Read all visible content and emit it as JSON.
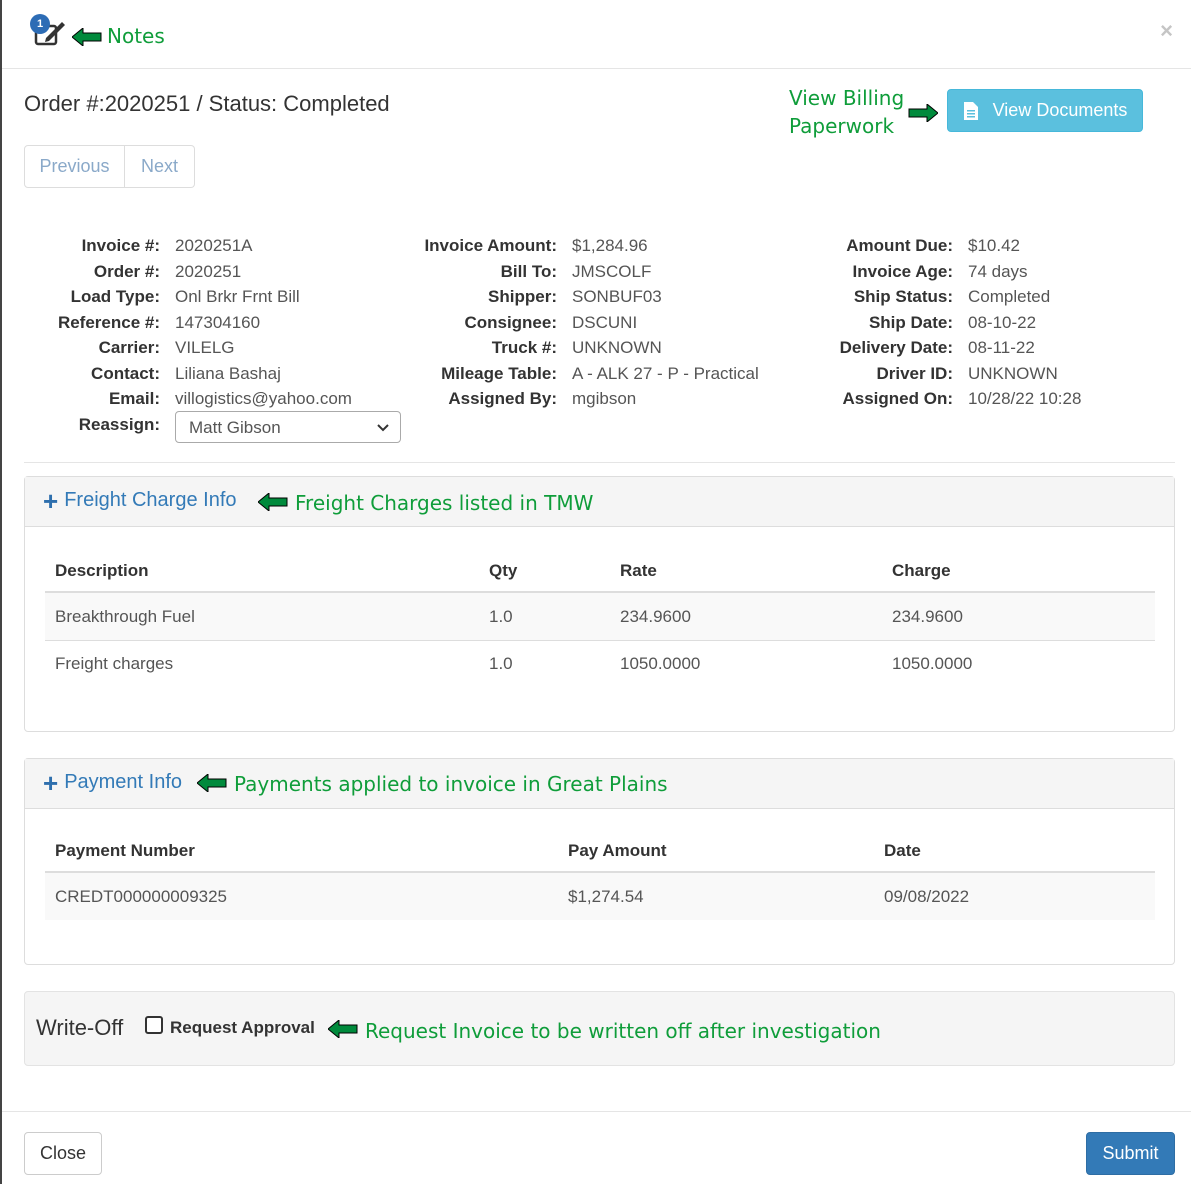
{
  "header": {
    "notes_badge": "1",
    "notes_annotation": "Notes",
    "close_symbol": "×"
  },
  "order": {
    "title": "Order #:2020251 / Status: Completed"
  },
  "pager": {
    "previous": "Previous",
    "next": "Next"
  },
  "view_docs": {
    "annotation_line1": "View Billing",
    "annotation_line2": "Paperwork",
    "label": "View Documents"
  },
  "info": {
    "col1": [
      {
        "label": "Invoice #:",
        "value": "2020251A"
      },
      {
        "label": "Order #:",
        "value": "2020251"
      },
      {
        "label": "Load Type:",
        "value": "Onl Brkr Frnt Bill"
      },
      {
        "label": "Reference #:",
        "value": "147304160"
      },
      {
        "label": "Carrier:",
        "value": "VILELG"
      },
      {
        "label": "Contact:",
        "value": "Liliana Bashaj"
      },
      {
        "label": "Email:",
        "value": "villogistics@yahoo.com"
      },
      {
        "label": "Reassign:",
        "value": "Matt Gibson"
      }
    ],
    "col2": [
      {
        "label": "Invoice Amount:",
        "value": "$1,284.96"
      },
      {
        "label": "Bill To:",
        "value": "JMSCOLF"
      },
      {
        "label": "Shipper:",
        "value": "SONBUF03"
      },
      {
        "label": "Consignee:",
        "value": "DSCUNI"
      },
      {
        "label": "Truck #:",
        "value": "UNKNOWN"
      },
      {
        "label": "Mileage Table:",
        "value": "A - ALK 27 - P - Practical"
      },
      {
        "label": "Assigned By:",
        "value": "mgibson"
      }
    ],
    "col3": [
      {
        "label": "Amount Due:",
        "value": "$10.42"
      },
      {
        "label": "Invoice Age:",
        "value": "74 days"
      },
      {
        "label": "Ship Status:",
        "value": "Completed"
      },
      {
        "label": "Ship Date:",
        "value": "08-10-22"
      },
      {
        "label": "Delivery Date:",
        "value": "08-11-22"
      },
      {
        "label": "Driver ID:",
        "value": "UNKNOWN"
      },
      {
        "label": "Assigned On:",
        "value": "10/28/22 10:28"
      }
    ]
  },
  "freight": {
    "title": "Freight Charge Info",
    "annotation": "Freight Charges listed in TMW",
    "headers": [
      "Description",
      "Qty",
      "Rate",
      "Charge"
    ],
    "rows": [
      [
        "Breakthrough Fuel",
        "1.0",
        "234.9600",
        "234.9600"
      ],
      [
        "Freight charges",
        "1.0",
        "1050.0000",
        "1050.0000"
      ]
    ]
  },
  "payment": {
    "title": "Payment Info",
    "annotation": "Payments applied to invoice in Great Plains",
    "headers": [
      "Payment Number",
      "Pay Amount",
      "Date"
    ],
    "rows": [
      [
        "CREDT000000009325",
        "$1,274.54",
        "09/08/2022"
      ]
    ]
  },
  "writeoff": {
    "label": "Write-Off",
    "checkbox_label": "Request Approval",
    "annotation": "Request Invoice to be written off after investigation"
  },
  "footer": {
    "close": "Close",
    "submit": "Submit"
  },
  "colors": {
    "annotation": "#0f9d3a",
    "arrow": "#008a3c",
    "link": "#337ab7",
    "info_button": "#5bc0de",
    "primary": "#337ab7"
  }
}
